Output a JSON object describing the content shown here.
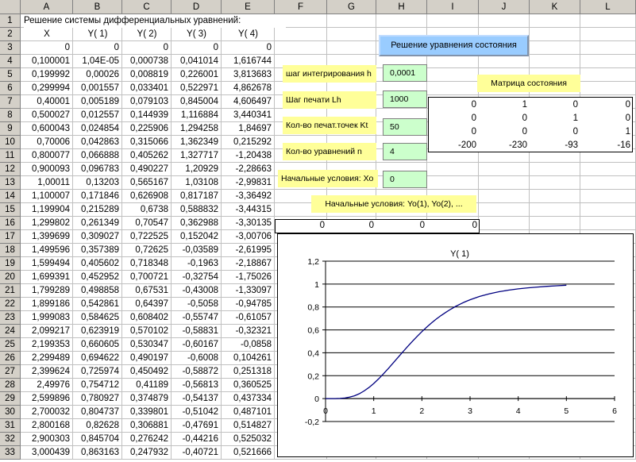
{
  "sheet": {
    "columns": [
      "A",
      "B",
      "C",
      "D",
      "E",
      "F",
      "G",
      "H",
      "I",
      "J",
      "K",
      "L"
    ],
    "title": "Решение системы дифференциальных уравнений:",
    "headers": [
      "X",
      "Y( 1)",
      "Y( 2)",
      "Y( 3)",
      "Y( 4)"
    ],
    "row3": [
      "0",
      "0",
      "0",
      "0",
      "0"
    ],
    "rows": [
      [
        "0,100001",
        "1,04E-05",
        "0,000738",
        "0,041014",
        "1,616744"
      ],
      [
        "0,199992",
        "0,00026",
        "0,008819",
        "0,226001",
        "3,813683"
      ],
      [
        "0,299994",
        "0,001557",
        "0,033401",
        "0,522971",
        "4,862678"
      ],
      [
        "0,40001",
        "0,005189",
        "0,079103",
        "0,845004",
        "4,606497"
      ],
      [
        "0,500027",
        "0,012557",
        "0,144939",
        "1,116884",
        "3,440341"
      ],
      [
        "0,600043",
        "0,024854",
        "0,225906",
        "1,294258",
        "1,84697"
      ],
      [
        "0,70006",
        "0,042863",
        "0,315066",
        "1,362349",
        "0,215292"
      ],
      [
        "0,800077",
        "0,066888",
        "0,405262",
        "1,327717",
        "-1,20438"
      ],
      [
        "0,900093",
        "0,096783",
        "0,490227",
        "1,20929",
        "-2,28663"
      ],
      [
        "1,00011",
        "0,13203",
        "0,565167",
        "1,03108",
        "-2,99831"
      ],
      [
        "1,100007",
        "0,171846",
        "0,626908",
        "0,817187",
        "-3,36492"
      ],
      [
        "1,199904",
        "0,215289",
        "0,6738",
        "0,588832",
        "-3,44315"
      ],
      [
        "1,299802",
        "0,261349",
        "0,70547",
        "0,362988",
        "-3,30135"
      ],
      [
        "1,399699",
        "0,309027",
        "0,722525",
        "0,152042",
        "-3,00706"
      ],
      [
        "1,499596",
        "0,357389",
        "0,72625",
        "-0,03589",
        "-2,61995"
      ],
      [
        "1,599494",
        "0,405602",
        "0,718348",
        "-0,1963",
        "-2,18867"
      ],
      [
        "1,699391",
        "0,452952",
        "0,700721",
        "-0,32754",
        "-1,75026"
      ],
      [
        "1,799289",
        "0,498858",
        "0,67531",
        "-0,43008",
        "-1,33097"
      ],
      [
        "1,899186",
        "0,542861",
        "0,64397",
        "-0,5058",
        "-0,94785"
      ],
      [
        "1,999083",
        "0,584625",
        "0,608402",
        "-0,55747",
        "-0,61057"
      ],
      [
        "2,099217",
        "0,623919",
        "0,570102",
        "-0,58831",
        "-0,32321"
      ],
      [
        "2,199353",
        "0,660605",
        "0,530347",
        "-0,60167",
        "-0,0858"
      ],
      [
        "2,299489",
        "0,694622",
        "0,490197",
        "-0,6008",
        "0,104261"
      ],
      [
        "2,399624",
        "0,725974",
        "0,450492",
        "-0,58872",
        "0,251318"
      ],
      [
        "2,49976",
        "0,754712",
        "0,41189",
        "-0,56813",
        "0,360525"
      ],
      [
        "2,599896",
        "0,780927",
        "0,374879",
        "-0,54137",
        "0,437334"
      ],
      [
        "2,700032",
        "0,804737",
        "0,339801",
        "-0,51042",
        "0,487101"
      ],
      [
        "2,800168",
        "0,82628",
        "0,306881",
        "-0,47691",
        "0,514827"
      ],
      [
        "2,900303",
        "0,845704",
        "0,276242",
        "-0,44216",
        "0,525032"
      ],
      [
        "3,000439",
        "0,863163",
        "0,247932",
        "-0,40721",
        "0,521666"
      ]
    ]
  },
  "controls": {
    "solve_button": "Решение уравнения состояния",
    "step_label": "шаг интегрирования  h",
    "step_value": "0,0001",
    "print_step_label": "Шаг печати  Lh",
    "print_step_value": "1000",
    "print_points_label": "Кол-во печат.точек  Kt",
    "print_points_value": "50",
    "equations_label": "Кол-во уравнений  n",
    "equations_value": "4",
    "x0_label": "Начальные условия: Хо",
    "x0_value": "0",
    "matrix_label": "Матрица состояния",
    "matrix": [
      [
        "0",
        "1",
        "0",
        "0"
      ],
      [
        "0",
        "0",
        "1",
        "0"
      ],
      [
        "0",
        "0",
        "0",
        "1"
      ],
      [
        "-200",
        "-230",
        "-93",
        "-16"
      ]
    ],
    "y0_label": "Начальные условия: Yo(1),  Yo(2), ...",
    "y0_values": [
      "0",
      "0",
      "0",
      "0"
    ]
  },
  "chart_data": {
    "type": "line",
    "title": "Y( 1)",
    "xlabel": "",
    "ylabel": "",
    "xlim": [
      0,
      6
    ],
    "ylim": [
      -0.2,
      1.2
    ],
    "xticks": [
      "0",
      "1",
      "2",
      "3",
      "4",
      "5",
      "6"
    ],
    "yticks": [
      "-0,2",
      "0",
      "0,2",
      "0,4",
      "0,6",
      "0,8",
      "1",
      "1,2"
    ],
    "grid": "horizontal",
    "series": [
      {
        "name": "Y( 1)",
        "color": "#000080",
        "x": [
          0,
          0.1,
          0.2,
          0.3,
          0.4,
          0.5,
          0.6,
          0.7,
          0.8,
          0.9,
          1.0,
          1.1,
          1.2,
          1.3,
          1.4,
          1.5,
          1.6,
          1.7,
          1.8,
          1.9,
          2.0,
          2.1,
          2.2,
          2.3,
          2.4,
          2.5,
          2.6,
          2.7,
          2.8,
          2.9,
          3.0,
          3.2,
          3.4,
          3.6,
          3.8,
          4.0,
          4.2,
          4.4,
          4.6,
          4.8,
          5.0
        ],
        "y": [
          0,
          1e-05,
          0.00026,
          0.0016,
          0.0052,
          0.0126,
          0.0249,
          0.0429,
          0.0669,
          0.0968,
          0.132,
          0.1718,
          0.2153,
          0.2613,
          0.309,
          0.3574,
          0.4056,
          0.453,
          0.4989,
          0.5429,
          0.5846,
          0.6239,
          0.6606,
          0.6946,
          0.726,
          0.7547,
          0.7809,
          0.8047,
          0.8263,
          0.8457,
          0.8632,
          0.892,
          0.915,
          0.933,
          0.947,
          0.958,
          0.967,
          0.974,
          0.98,
          0.985,
          0.99
        ]
      }
    ]
  }
}
